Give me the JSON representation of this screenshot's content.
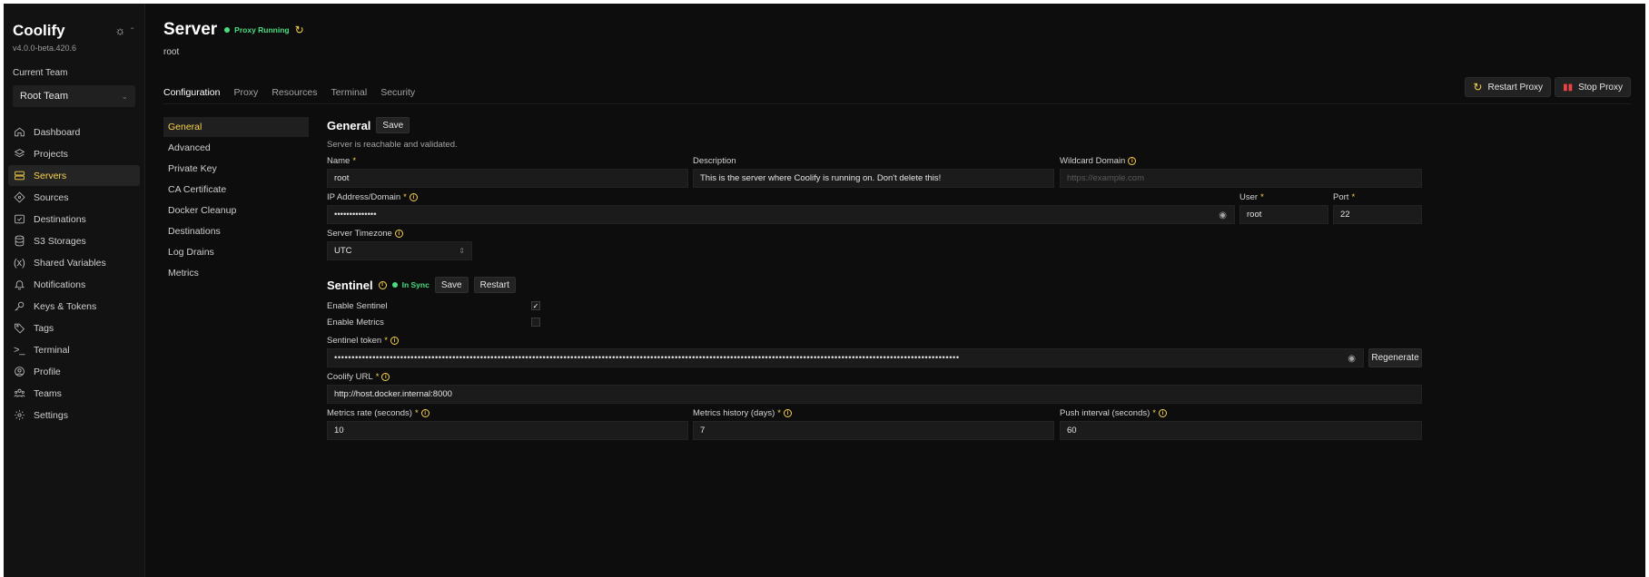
{
  "sidebar": {
    "brand": "Coolify",
    "version": "v4.0.0-beta.420.6",
    "theme_icon": "sun-icon",
    "team_label": "Current Team",
    "team_value": "Root Team",
    "items": [
      {
        "label": "Dashboard",
        "icon": "home-icon"
      },
      {
        "label": "Projects",
        "icon": "layers-icon"
      },
      {
        "label": "Servers",
        "icon": "server-icon"
      },
      {
        "label": "Sources",
        "icon": "git-icon"
      },
      {
        "label": "Destinations",
        "icon": "destination-icon"
      },
      {
        "label": "S3 Storages",
        "icon": "database-icon"
      },
      {
        "label": "Shared Variables",
        "icon": "variable-icon"
      },
      {
        "label": "Notifications",
        "icon": "bell-icon"
      },
      {
        "label": "Keys & Tokens",
        "icon": "key-icon"
      },
      {
        "label": "Tags",
        "icon": "tag-icon"
      },
      {
        "label": "Terminal",
        "icon": "terminal-icon"
      },
      {
        "label": "Profile",
        "icon": "profile-icon"
      },
      {
        "label": "Teams",
        "icon": "users-icon"
      },
      {
        "label": "Settings",
        "icon": "gear-icon"
      }
    ]
  },
  "header": {
    "title": "Server",
    "status": "Proxy Running",
    "subtitle": "root",
    "tabs": [
      "Configuration",
      "Proxy",
      "Resources",
      "Terminal",
      "Security"
    ],
    "restart_proxy": "Restart Proxy",
    "stop_proxy": "Stop Proxy"
  },
  "sub_nav": [
    "General",
    "Advanced",
    "Private Key",
    "CA Certificate",
    "Docker Cleanup",
    "Destinations",
    "Log Drains",
    "Metrics"
  ],
  "general": {
    "title": "General",
    "save": "Save",
    "hint": "Server is reachable and validated.",
    "name_label": "Name",
    "name_value": "root",
    "description_label": "Description",
    "description_value": "This is the server where Coolify is running on. Don't delete this!",
    "wildcard_label": "Wildcard Domain",
    "wildcard_placeholder": "https://example.com",
    "ip_label": "IP Address/Domain",
    "ip_value": "••••••••••••••",
    "user_label": "User",
    "user_value": "root",
    "port_label": "Port",
    "port_value": "22",
    "tz_label": "Server Timezone",
    "tz_value": "UTC"
  },
  "sentinel": {
    "title": "Sentinel",
    "status": "In Sync",
    "save": "Save",
    "restart": "Restart",
    "enable_sentinel": "Enable Sentinel",
    "enable_metrics": "Enable Metrics",
    "token_label": "Sentinel token",
    "token_value": "••••••••••••••••••••••••••••••••••••••••••••••••••••••••••••••••••••••••••••••••••••••••••••••••••••••••••••••••••••••••••••••••••••••••••••••••••••••••••••••••••••••••••••••••••••",
    "regenerate": "Regenerate",
    "url_label": "Coolify URL",
    "url_value": "http://host.docker.internal:8000",
    "rate_label": "Metrics rate (seconds)",
    "rate_value": "10",
    "history_label": "Metrics history (days)",
    "history_value": "7",
    "push_label": "Push interval (seconds)",
    "push_value": "60"
  },
  "colors": {
    "accent": "#fcd34d",
    "success": "#4ade80",
    "danger": "#ef4444"
  }
}
